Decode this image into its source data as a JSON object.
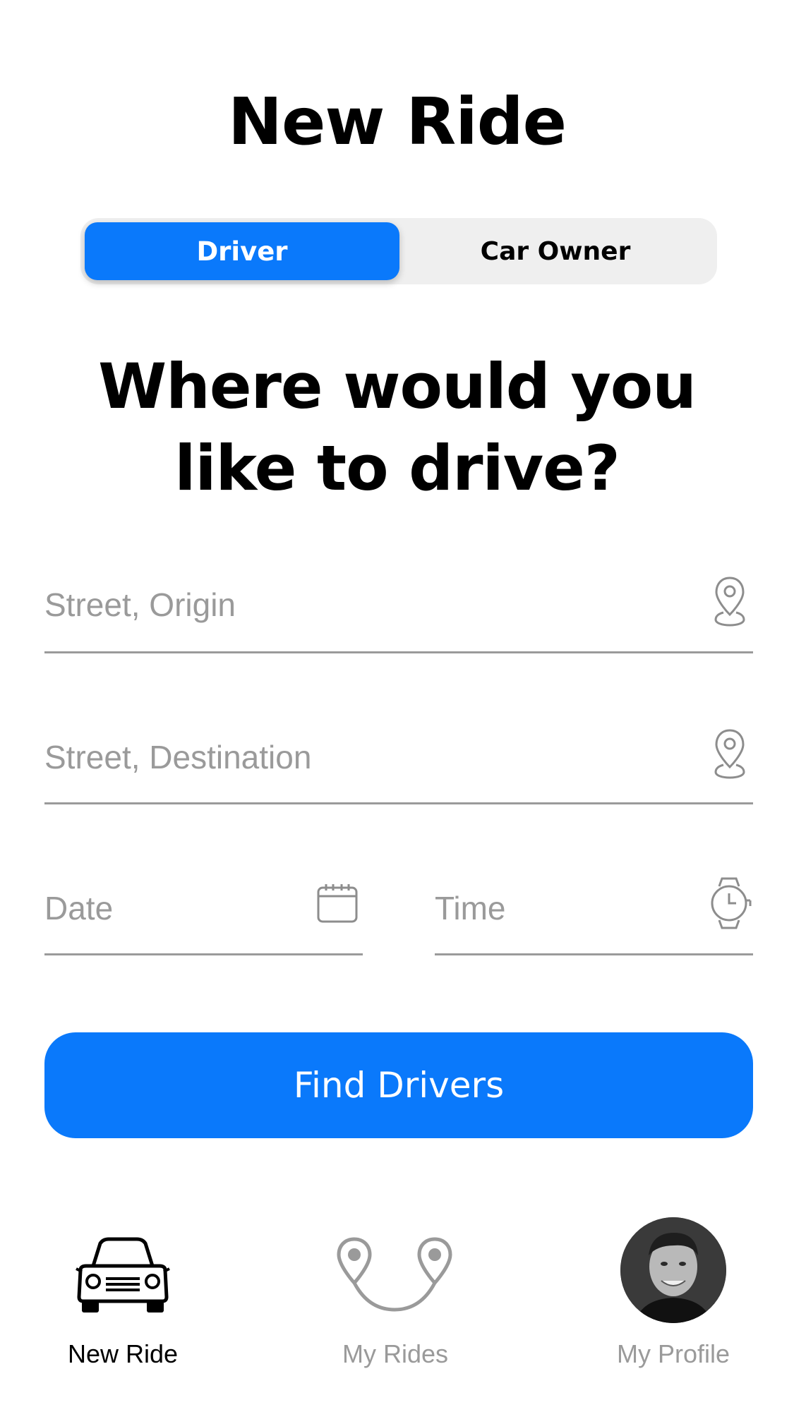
{
  "header": {
    "title": "New Ride"
  },
  "mode_toggle": {
    "options": [
      "Driver",
      "Car Owner"
    ],
    "selected": "Driver"
  },
  "prompt": {
    "line1": "Where would you",
    "line2": "like to drive?"
  },
  "form": {
    "origin_placeholder": "Street, Origin",
    "destination_placeholder": "Street, Destination",
    "date_placeholder": "Date",
    "time_placeholder": "Time"
  },
  "actions": {
    "find_label": "Find Drivers"
  },
  "tab_bar": {
    "items": [
      {
        "label": "New Ride",
        "icon": "car-icon",
        "active": true
      },
      {
        "label": "My Rides",
        "icon": "route-pins-icon",
        "active": false
      },
      {
        "label": "My Profile",
        "icon": "avatar",
        "active": false
      }
    ]
  },
  "colors": {
    "accent": "#0a79fb",
    "muted": "#9a9a9a",
    "toggle_bg": "#efefef"
  }
}
